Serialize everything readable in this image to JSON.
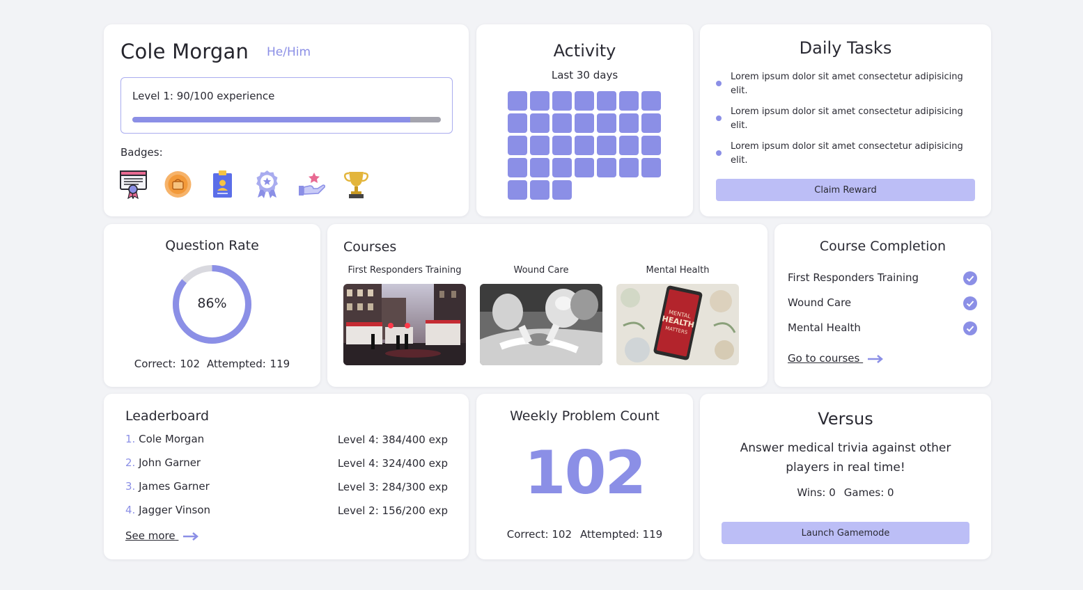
{
  "colors": {
    "accent": "#8b8fe6",
    "button": "#bcbef6",
    "background": "#f2f3f6"
  },
  "profile": {
    "name": "Cole Morgan",
    "pronouns": "He/Him",
    "level_text": "Level 1: 90/100 experience",
    "xp_fraction": 0.9,
    "badges_label": "Badges:",
    "badges": [
      "certificate-badge-icon",
      "medal-badge-icon",
      "id-card-badge-icon",
      "award-ribbon-icon",
      "helping-hand-star-icon",
      "trophy-icon"
    ]
  },
  "activity": {
    "title": "Activity",
    "subtitle": "Last 30 days",
    "active_days": 31
  },
  "tasks": {
    "title": "Daily Tasks",
    "items": [
      "Lorem ipsum dolor sit amet consectetur adipisicing elit.",
      "Lorem ipsum dolor sit amet consectetur adipisicing elit.",
      "Lorem ipsum dolor sit amet consectetur adipisicing elit."
    ],
    "claim_label": "Claim Reward"
  },
  "question_rate": {
    "title": "Question Rate",
    "percent": "86%",
    "fraction": 0.86,
    "correct": "Correct: 102",
    "attempted": "Attempted: 119"
  },
  "courses": {
    "title": "Courses",
    "items": [
      {
        "name": "First Responders Training"
      },
      {
        "name": "Wound Care"
      },
      {
        "name": "Mental Health"
      }
    ]
  },
  "completion": {
    "title": "Course Completion",
    "items": [
      "First Responders Training",
      "Wound Care",
      "Mental Health"
    ],
    "link_label": "Go to courses"
  },
  "leaderboard": {
    "title": "Leaderboard",
    "rows": [
      {
        "rank": "1.",
        "name": "Cole Morgan",
        "level": "Level 4: 384/400 exp"
      },
      {
        "rank": "2.",
        "name": "John Garner",
        "level": "Level 4: 324/400 exp"
      },
      {
        "rank": "3.",
        "name": "James Garner",
        "level": "Level 3: 284/300 exp"
      },
      {
        "rank": "4.",
        "name": "Jagger Vinson",
        "level": "Level 2: 156/200 exp"
      }
    ],
    "see_more": "See more"
  },
  "weekly": {
    "title": "Weekly Problem Count",
    "count": "102",
    "correct": "Correct: 102",
    "attempted": "Attempted: 119"
  },
  "versus": {
    "title": "Versus",
    "description": "Answer medical trivia against other players in real time!",
    "wins": "Wins: 0",
    "games": "Games: 0",
    "launch_label": "Launch Gamemode"
  }
}
